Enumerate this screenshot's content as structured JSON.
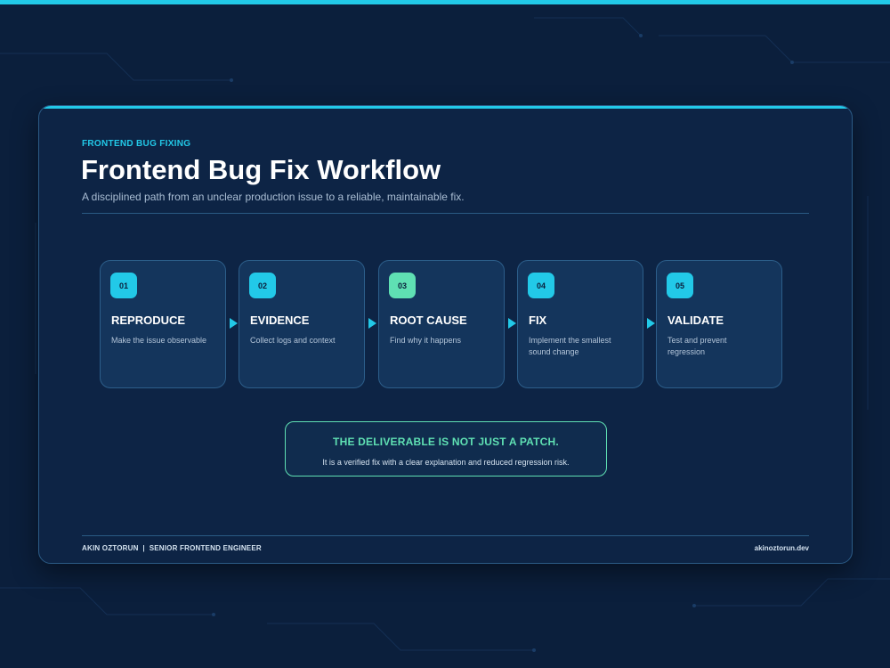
{
  "slide": {
    "eyebrow": "FRONTEND BUG FIXING",
    "title": "Frontend Bug Fix Workflow",
    "subtitle": "A disciplined path from an unclear production issue to a reliable, maintainable fix."
  },
  "steps": [
    {
      "number": "01",
      "title": "REPRODUCE",
      "description": "Make the issue observable"
    },
    {
      "number": "02",
      "title": "EVIDENCE",
      "description": "Collect logs and context"
    },
    {
      "number": "03",
      "title": "ROOT CAUSE",
      "description": "Find why it happens"
    },
    {
      "number": "04",
      "title": "FIX",
      "description": "Implement the smallest sound change"
    },
    {
      "number": "05",
      "title": "VALIDATE",
      "description": "Test and prevent regression"
    }
  ],
  "deliverable": {
    "title": "THE DELIVERABLE IS NOT JUST A PATCH.",
    "text": "It is a verified fix with a clear explanation and reduced regression risk."
  },
  "footer": {
    "author": "AKIN OZTORUN  |  SENIOR FRONTEND ENGINEER",
    "site": "akinoztorun.dev"
  },
  "colors": {
    "background": "#0b1f3c",
    "accent": "#22c9e8",
    "highlight": "#5fe0b3"
  },
  "icons": [
    "chevron-right-icon"
  ]
}
